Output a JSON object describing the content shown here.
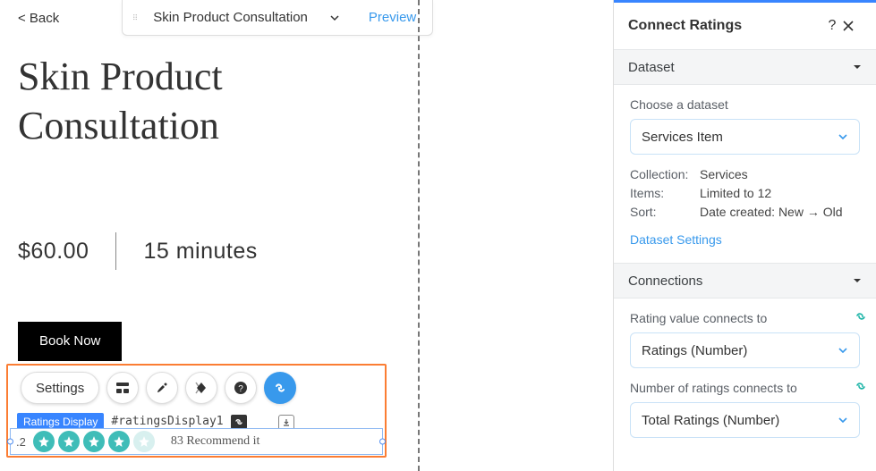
{
  "topbar": {
    "back": "< Back",
    "page_name": "Skin Product Consultation",
    "preview": "Preview"
  },
  "page": {
    "title": "Skin Product Consultation",
    "price": "$60.00",
    "duration": "15 minutes",
    "book_label": "Book Now"
  },
  "selection": {
    "settings_label": "Settings",
    "component_label": "Ratings Display",
    "component_id": "#ratingsDisplay1",
    "rating_value": ".2",
    "recommend_text": "83 Recommend it"
  },
  "panel": {
    "title": "Connect Ratings",
    "sections": {
      "dataset": "Dataset",
      "connections": "Connections"
    },
    "dataset": {
      "choose_label": "Choose a dataset",
      "selected": "Services Item",
      "collection_k": "Collection:",
      "collection_v": "Services",
      "items_k": "Items:",
      "items_v": "Limited to 12",
      "sort_k": "Sort:",
      "sort_v": "Date created: New → Old",
      "settings_link": "Dataset Settings"
    },
    "connections": {
      "rating_label": "Rating value connects to",
      "rating_selected": "Ratings (Number)",
      "count_label": "Number of ratings connects to",
      "count_selected": "Total Ratings (Number)"
    }
  }
}
